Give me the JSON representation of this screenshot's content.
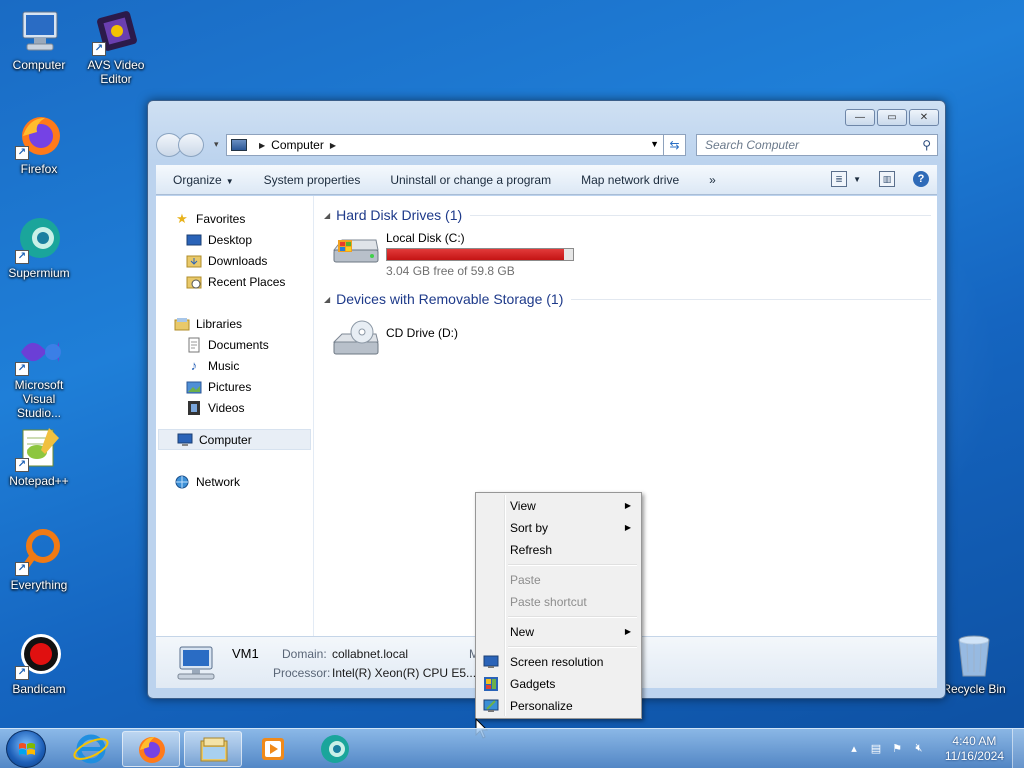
{
  "desktop": {
    "icons": [
      {
        "label": "Computer"
      },
      {
        "label": "AVS Video Editor"
      },
      {
        "label": "Firefox"
      },
      {
        "label": "Supermium"
      },
      {
        "label": "Microsoft Visual Studio..."
      },
      {
        "label": "Notepad++"
      },
      {
        "label": "Everything"
      },
      {
        "label": "Bandicam"
      },
      {
        "label": "Recycle Bin"
      }
    ]
  },
  "window": {
    "address": {
      "location": "Computer"
    },
    "search": {
      "placeholder": "Search Computer"
    },
    "toolbar": {
      "organize": "Organize",
      "system_properties": "System properties",
      "uninstall": "Uninstall or change a program",
      "map_drive": "Map network drive",
      "more": "»"
    },
    "nav": {
      "favorites": "Favorites",
      "desktop": "Desktop",
      "downloads": "Downloads",
      "recent": "Recent Places",
      "libraries": "Libraries",
      "documents": "Documents",
      "music": "Music",
      "pictures": "Pictures",
      "videos": "Videos",
      "computer": "Computer",
      "network": "Network"
    },
    "groups": {
      "hard_disks": "Hard Disk Drives (1)",
      "removable": "Devices with Removable Storage (1)"
    },
    "drives": {
      "c": {
        "name": "Local Disk (C:)",
        "free": "3.04 GB free of 59.8 GB",
        "used_fraction": 0.949
      },
      "d": {
        "name": "CD Drive (D:)"
      }
    },
    "details": {
      "name": "VM1",
      "domain_label": "Domain:",
      "domain": "collabnet.local",
      "processor_label": "Processor:",
      "processor": "Intel(R) Xeon(R) CPU E5...",
      "memory_label": "Me"
    }
  },
  "context_menu": {
    "view": "View",
    "sort_by": "Sort by",
    "refresh": "Refresh",
    "paste": "Paste",
    "paste_shortcut": "Paste shortcut",
    "new": "New",
    "screen_resolution": "Screen resolution",
    "gadgets": "Gadgets",
    "personalize": "Personalize"
  },
  "taskbar": {
    "time": "4:40 AM",
    "date": "11/16/2024"
  },
  "colors": {
    "disk_bar_red": "#d42020",
    "accent_blue": "#1e3a8a"
  }
}
